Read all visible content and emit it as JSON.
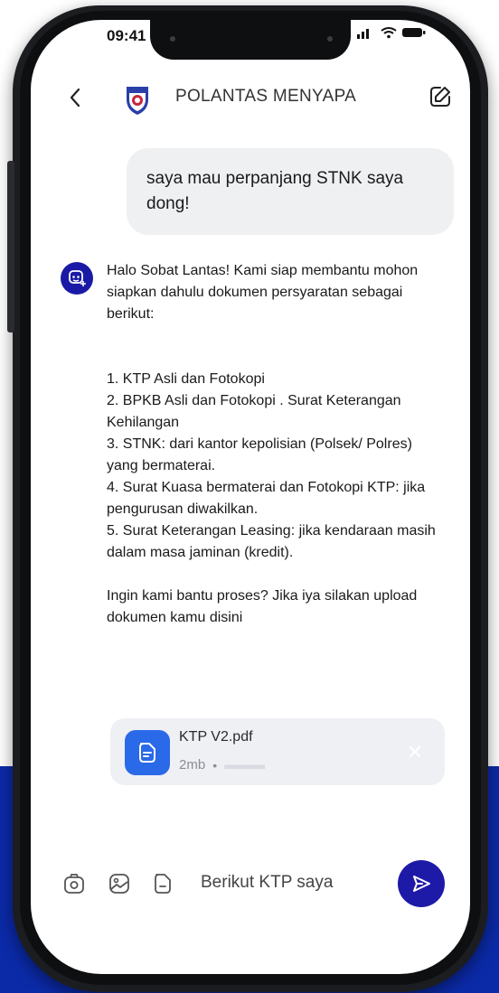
{
  "status_bar": {
    "time": "09:41"
  },
  "header": {
    "title": "POLANTAS MENYAPA",
    "back_icon": "chevron-left-icon",
    "edit_icon": "edit-icon"
  },
  "messages": {
    "user": "saya mau perpanjang STNK saya dong!",
    "bot": {
      "intro": "Halo Sobat Lantas! Kami siap membantu mohon siapkan dahulu dokumen persyaratan sebagai berikut:",
      "items": [
        "1. KTP Asli dan Fotokopi",
        "2. BPKB Asli dan Fotokopi . Surat Keterangan Kehilangan",
        "3. STNK: dari kantor kepolisian (Polsek/ Polres) yang bermaterai.",
        "4. Surat Kuasa bermaterai dan Fotokopi KTP: jika pengurusan diwakilkan.",
        "5. Surat Keterangan Leasing: jika kendaraan masih dalam masa jaminan (kredit)."
      ],
      "closing": "Ingin kami bantu proses? Jika iya silakan upload dokumen kamu disini"
    }
  },
  "attachment": {
    "file_name": "KTP V2.pdf",
    "file_size": "2mb",
    "separator": "•"
  },
  "composer": {
    "input_value": "Berikut KTP saya",
    "tools": [
      "camera-icon",
      "image-icon",
      "file-icon"
    ]
  },
  "colors": {
    "brand_blue": "#1e1aa8",
    "file_blue": "#2a69e8",
    "backdrop_blue": "#0b2aa8",
    "bubble_gray": "#eff0f2"
  }
}
